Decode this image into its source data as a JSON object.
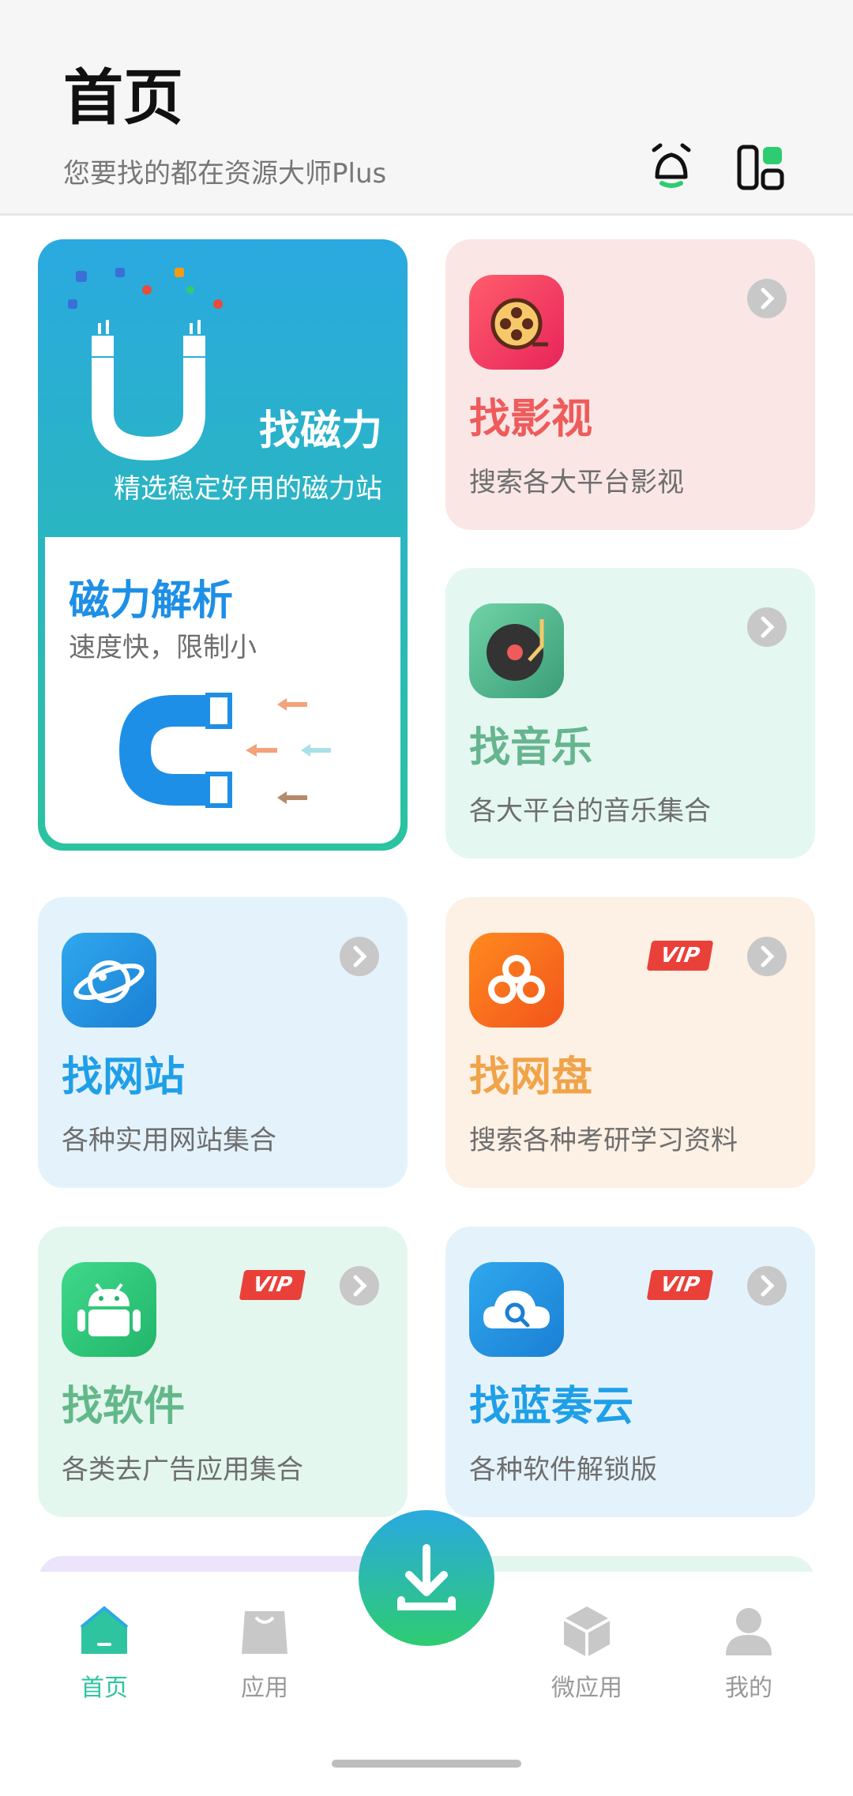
{
  "header": {
    "title": "首页",
    "subtitle": "您要找的都在资源大师Plus"
  },
  "magnet_card": {
    "title": "找磁力",
    "desc": "精选稳定好用的磁力站",
    "sub_title": "磁力解析",
    "sub_desc": "速度快，限制小"
  },
  "cards": [
    {
      "title": "找影视",
      "desc": "搜索各大平台影视",
      "title_color": "#ef5b5b",
      "vip": false
    },
    {
      "title": "找音乐",
      "desc": "各大平台的音乐集合",
      "title_color": "#66b58f",
      "vip": false
    },
    {
      "title": "找网站",
      "desc": "各种实用网站集合",
      "title_color": "#1f9fe8",
      "vip": false
    },
    {
      "title": "找网盘",
      "desc": "搜索各种考研学习资料",
      "title_color": "#f0a348",
      "vip": true
    },
    {
      "title": "找软件",
      "desc": "各类去广告应用集合",
      "title_color": "#62b889",
      "vip": true
    },
    {
      "title": "找蓝奏云",
      "desc": "各种软件解锁版",
      "title_color": "#1f9fe8",
      "vip": true
    }
  ],
  "vip_label": "VIP",
  "nav": {
    "items": [
      {
        "label": "首页",
        "active": true
      },
      {
        "label": "应用",
        "active": false
      },
      {
        "label": "微应用",
        "active": false
      },
      {
        "label": "我的",
        "active": false
      }
    ]
  },
  "colors": {
    "accent": "#2ec4a0",
    "vip": "#e9413a"
  }
}
